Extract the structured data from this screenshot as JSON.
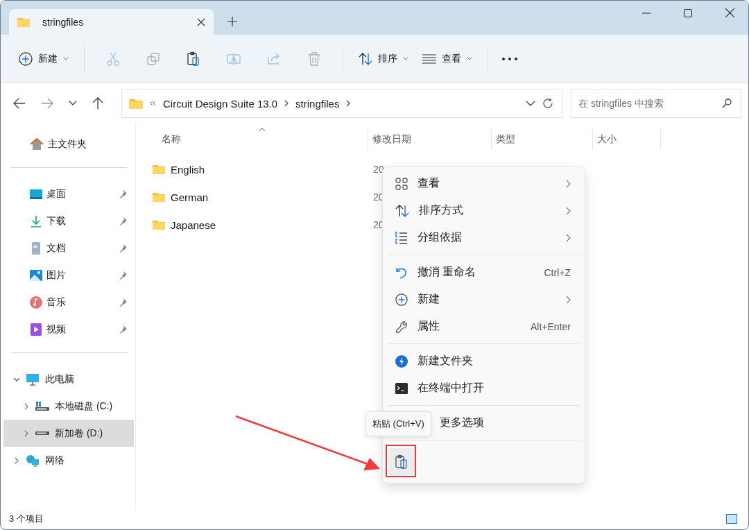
{
  "tab": {
    "title": "stringfiles",
    "selected": true
  },
  "toolbar": {
    "new_label": "新建",
    "tools": [
      {
        "kind": "cut",
        "disabled": true
      },
      {
        "kind": "copy",
        "disabled": true
      },
      {
        "kind": "paste",
        "disabled": false
      },
      {
        "kind": "rename",
        "disabled": true
      },
      {
        "kind": "share",
        "disabled": true
      },
      {
        "kind": "delete",
        "disabled": true
      }
    ],
    "sort_label": "排序",
    "view_label": "查看"
  },
  "address": {
    "crumbs": [
      "Circuit Design Suite 13.0",
      "stringfiles"
    ]
  },
  "search": {
    "placeholder": "在 stringfiles 中搜索"
  },
  "sidebar": {
    "home": "主文件夹",
    "quick": [
      {
        "label": "桌面",
        "pinned": true
      },
      {
        "label": "下载",
        "pinned": true
      },
      {
        "label": "文档",
        "pinned": true
      },
      {
        "label": "图片",
        "pinned": true
      },
      {
        "label": "音乐",
        "pinned": true
      },
      {
        "label": "视频",
        "pinned": true
      }
    ],
    "tree": [
      {
        "label": "此电脑",
        "expanded": true,
        "selected": false,
        "children": [
          {
            "label": "本地磁盘 (C:)",
            "expanded": false,
            "selected": false
          },
          {
            "label": "新加卷 (D:)",
            "expanded": false,
            "selected": true
          }
        ]
      },
      {
        "label": "网络",
        "expanded": false,
        "selected": false
      }
    ]
  },
  "table": {
    "columns": [
      "名称",
      "修改日期",
      "类型",
      "大小"
    ],
    "rows": [
      {
        "name": "English",
        "modified": "20",
        "type": ""
      },
      {
        "name": "German",
        "modified": "20",
        "type": ""
      },
      {
        "name": "Japanese",
        "modified": "20",
        "type": ""
      }
    ]
  },
  "context_menu": {
    "groups": [
      [
        {
          "label": "查看",
          "submenu": true
        },
        {
          "label": "排序方式",
          "submenu": true
        },
        {
          "label": "分组依据",
          "submenu": true
        }
      ],
      [
        {
          "label": "撤消 重命名",
          "shortcut": "Ctrl+Z",
          "submenu": false
        },
        {
          "label": "新建",
          "submenu": true
        },
        {
          "label": "属性",
          "shortcut": "Alt+Enter",
          "submenu": false
        }
      ],
      [
        {
          "label": "新建文件夹",
          "submenu": false
        },
        {
          "label": "在终端中打开",
          "submenu": false
        }
      ],
      [
        {
          "label": "更多选项",
          "submenu": false
        }
      ]
    ]
  },
  "tooltip": "粘贴 (Ctrl+V)",
  "status_bar": {
    "count": "3 个项目"
  }
}
